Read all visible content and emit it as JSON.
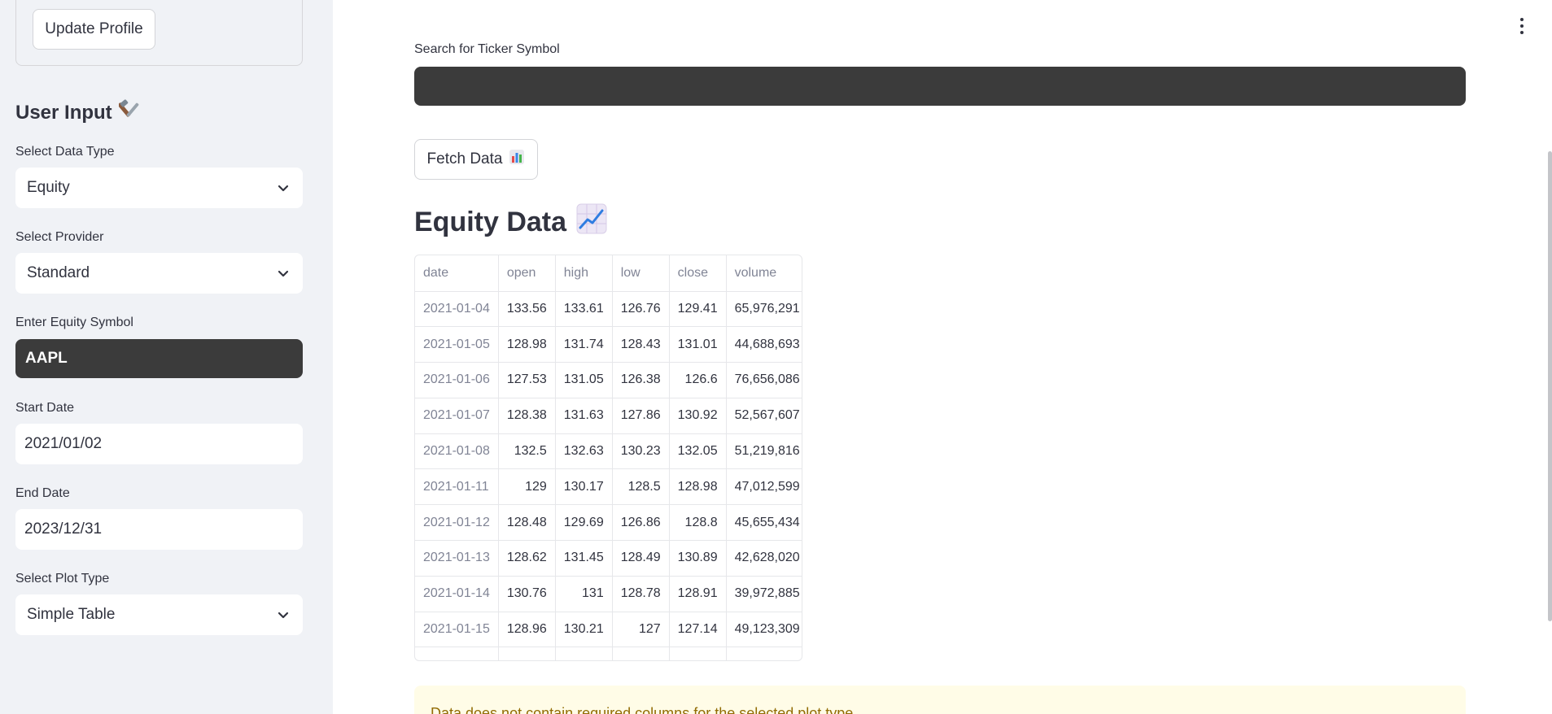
{
  "sidebar": {
    "update_profile_label": "Update Profile",
    "section_title": "User Input",
    "section_icon": "tools-emoji",
    "data_type": {
      "label": "Select Data Type",
      "value": "Equity"
    },
    "provider": {
      "label": "Select Provider",
      "value": "Standard"
    },
    "symbol": {
      "label": "Enter Equity Symbol",
      "value": "AAPL"
    },
    "start_date": {
      "label": "Start Date",
      "value": "2021/01/02"
    },
    "end_date": {
      "label": "End Date",
      "value": "2023/12/31"
    },
    "plot_type": {
      "label": "Select Plot Type",
      "value": "Simple Table"
    }
  },
  "main": {
    "search_label": "Search for Ticker Symbol",
    "search_value": "",
    "fetch_label": "Fetch Data",
    "fetch_icon": "bar-chart-emoji",
    "heading": "Equity Data",
    "heading_icon": "chart-increasing-emoji",
    "table": {
      "columns": [
        "date",
        "open",
        "high",
        "low",
        "close",
        "volume"
      ],
      "rows": [
        [
          "2021-01-04",
          "133.56",
          "133.61",
          "126.76",
          "129.41",
          "65,976,291"
        ],
        [
          "2021-01-05",
          "128.98",
          "131.74",
          "128.43",
          "131.01",
          "44,688,693"
        ],
        [
          "2021-01-06",
          "127.53",
          "131.05",
          "126.38",
          "126.6",
          "76,656,086"
        ],
        [
          "2021-01-07",
          "128.38",
          "131.63",
          "127.86",
          "130.92",
          "52,567,607"
        ],
        [
          "2021-01-08",
          "132.5",
          "132.63",
          "130.23",
          "132.05",
          "51,219,816"
        ],
        [
          "2021-01-11",
          "129",
          "130.17",
          "128.5",
          "128.98",
          "47,012,599"
        ],
        [
          "2021-01-12",
          "128.48",
          "129.69",
          "126.86",
          "128.8",
          "45,655,434"
        ],
        [
          "2021-01-13",
          "128.62",
          "131.45",
          "128.49",
          "130.89",
          "42,628,020"
        ],
        [
          "2021-01-14",
          "130.76",
          "131",
          "128.78",
          "128.91",
          "39,972,885"
        ],
        [
          "2021-01-15",
          "128.96",
          "130.21",
          "127",
          "127.14",
          "49,123,309"
        ]
      ]
    },
    "warning": "Data does not contain required columns for the selected plot type."
  },
  "colors": {
    "sidebar_bg": "#f0f2f6",
    "dark_input": "#3b3b3b",
    "warning_bg": "#fffce7",
    "warning_text": "#926c05",
    "text": "#31333f"
  }
}
